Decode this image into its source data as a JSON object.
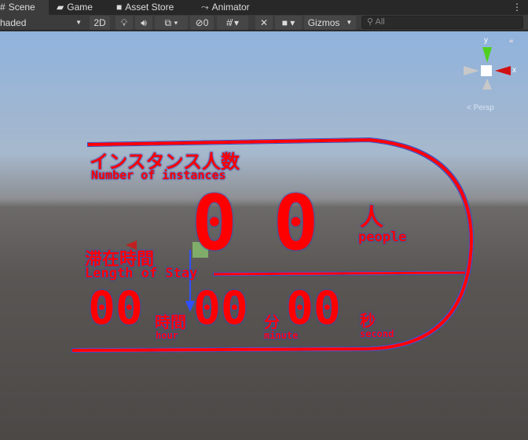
{
  "tabs": [
    {
      "label": "Scene",
      "icon": "hash-icon"
    },
    {
      "label": "Game",
      "icon": "gamepad-icon"
    },
    {
      "label": "Asset Store",
      "icon": "bag-icon"
    },
    {
      "label": "Animator",
      "icon": "animator-icon"
    }
  ],
  "toolbar": {
    "shading": "haded",
    "mode_2d": "2D",
    "hidden_count": "0",
    "gizmos": "Gizmos",
    "search_placeholder": "All"
  },
  "gizmo": {
    "y": "y",
    "x": "x",
    "persp": "Persp"
  },
  "overlay": {
    "title_jp": "インスタンス人数",
    "title_en": "Number of instances",
    "count": "0 0",
    "count_unit_jp": "人",
    "count_unit_en": "people",
    "stay_jp": "滞在時間",
    "stay_en": "Length of Stay",
    "hours": "00",
    "hours_jp": "時間",
    "hours_en": "hour",
    "minutes": "00",
    "minutes_jp": "分",
    "minutes_en": "minute",
    "seconds": "00",
    "seconds_jp": "秒",
    "seconds_en": "second"
  },
  "colors": {
    "accent": "#ff0000",
    "glow": "#3050c0"
  }
}
